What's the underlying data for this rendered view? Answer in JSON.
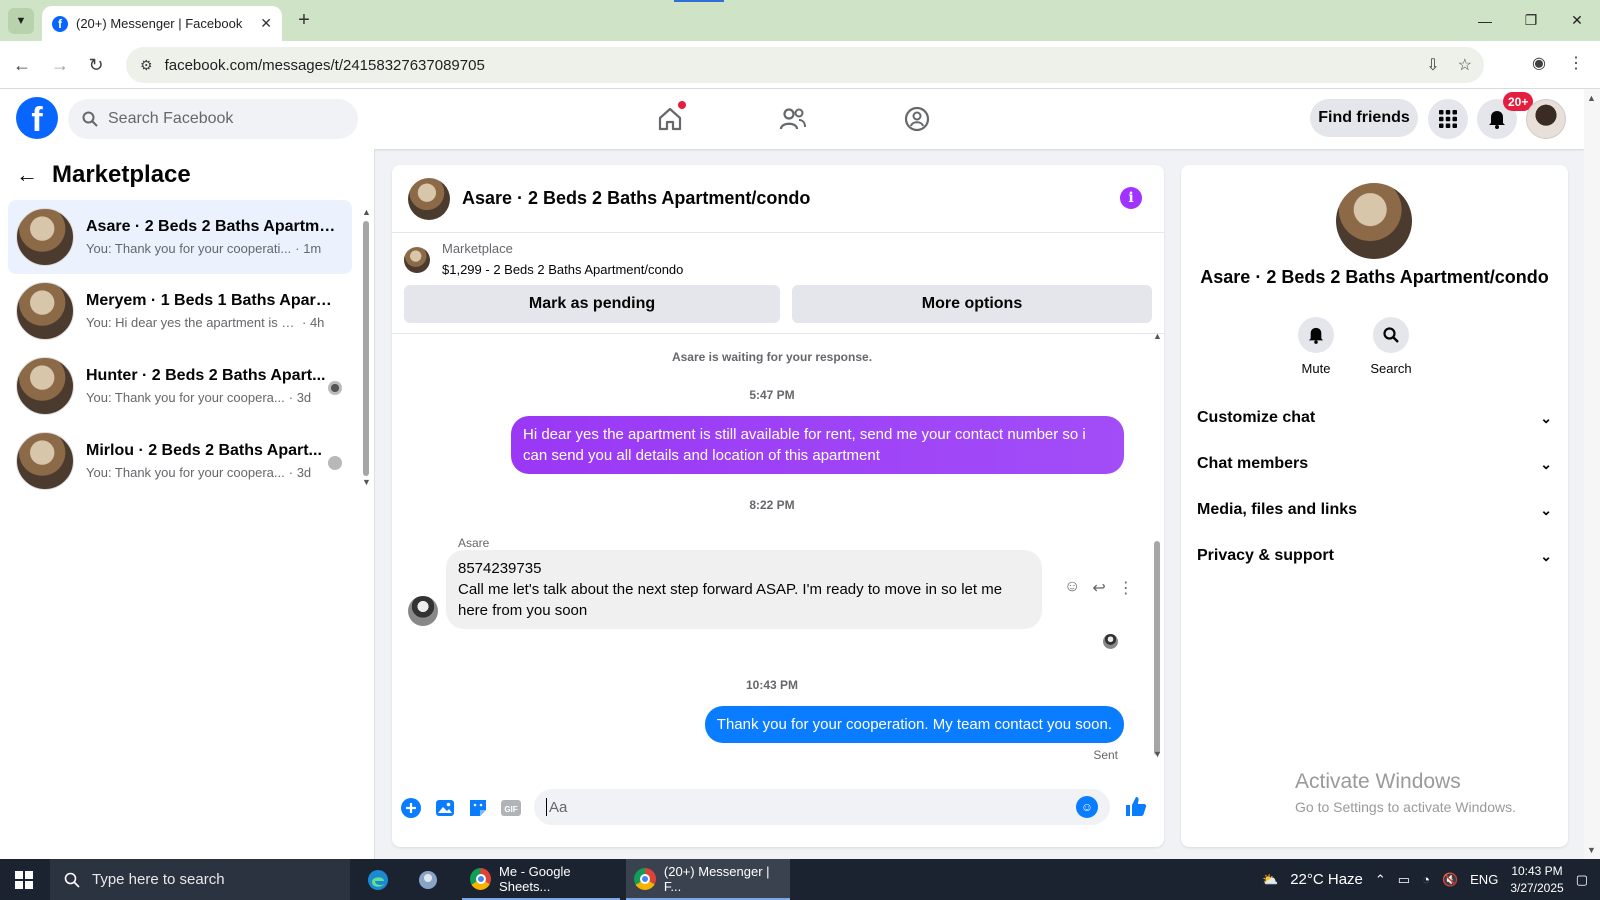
{
  "browser": {
    "tab_title": "(20+) Messenger | Facebook",
    "url": "facebook.com/messages/t/24158327637089705"
  },
  "facebook": {
    "search_placeholder": "Search Facebook",
    "find_friends": "Find friends",
    "notification_count": "20+"
  },
  "sidebar": {
    "title": "Marketplace",
    "conversations": [
      {
        "name": "Asare · 2 Beds 2 Baths Apartme...",
        "preview": "You: Thank you for your cooperati...",
        "time": "· 1m",
        "active": true
      },
      {
        "name": "Meryem · 1 Beds 1 Baths Apartm...",
        "preview": "You: Hi dear yes the apartment is st...",
        "time": "· 4h",
        "active": false
      },
      {
        "name": "Hunter · 2 Beds 2 Baths Apart...",
        "preview": "You: Thank you for your coopera...",
        "time": "· 3d",
        "active": false
      },
      {
        "name": "Mirlou · 2 Beds 2 Baths Apart...",
        "preview": "You: Thank you for your coopera...",
        "time": "· 3d",
        "active": false
      }
    ]
  },
  "chat": {
    "title": "Asare · 2 Beds 2 Baths Apartment/condo",
    "listing_source": "Marketplace",
    "listing_detail": "$1,299 - 2 Beds 2 Baths Apartment/condo",
    "mark_pending": "Mark as pending",
    "more_options": "More options",
    "waiting_note": "Asare is waiting for your response.",
    "time1": "5:47 PM",
    "msg_out1": "Hi dear yes the apartment is still available for rent, send me your contact number so i can send you all details and location of this apartment",
    "time2": "8:22 PM",
    "sender_name": "Asare",
    "msg_in_line1": "8574239735",
    "msg_in_line2": "Call me let's talk about the next step forward ASAP. I'm ready to move in so let me here from you soon",
    "time3": "10:43 PM",
    "msg_out2": "Thank you for your cooperation. My team contact you soon.",
    "sent_label": "Sent",
    "composer_placeholder": "Aa"
  },
  "info_panel": {
    "name": "Asare · 2 Beds 2 Baths Apartment/condo",
    "mute": "Mute",
    "search": "Search",
    "sections": [
      "Customize chat",
      "Chat members",
      "Media, files and links",
      "Privacy & support"
    ]
  },
  "watermark": {
    "line1": "Activate Windows",
    "line2": "Go to Settings to activate Windows."
  },
  "taskbar": {
    "search_placeholder": "Type here to search",
    "app1": "Me - Google Sheets...",
    "app2": "(20+) Messenger | F...",
    "weather": "22°C  Haze",
    "lang": "ENG",
    "time": "10:43 PM",
    "date": "3/27/2025"
  }
}
